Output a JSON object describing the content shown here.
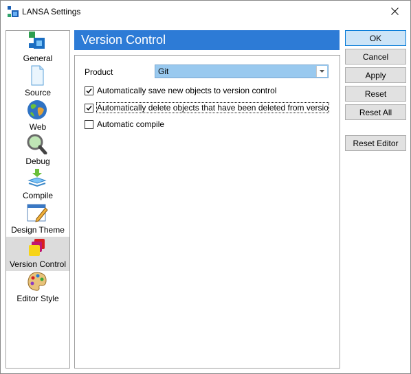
{
  "window": {
    "title": "LANSA Settings"
  },
  "sidebar": {
    "items": [
      {
        "label": "General",
        "icon": "general-icon"
      },
      {
        "label": "Source",
        "icon": "source-icon"
      },
      {
        "label": "Web",
        "icon": "globe-icon"
      },
      {
        "label": "Debug",
        "icon": "magnifier-icon"
      },
      {
        "label": "Compile",
        "icon": "compile-icon"
      },
      {
        "label": "Design Theme",
        "icon": "design-theme-icon"
      },
      {
        "label": "Version Control",
        "icon": "version-control-icon",
        "selected": true
      },
      {
        "label": "Editor Style",
        "icon": "palette-icon"
      }
    ]
  },
  "panel": {
    "title": "Version Control",
    "product_label": "Product",
    "product_value": "Git",
    "checkboxes": [
      {
        "label": "Automatically save new objects to version control",
        "checked": true
      },
      {
        "label": "Automatically delete objects that have been deleted from versio",
        "checked": true,
        "focused": true
      },
      {
        "label": "Automatic compile",
        "checked": false
      }
    ]
  },
  "buttons": {
    "ok": "OK",
    "cancel": "Cancel",
    "apply": "Apply",
    "reset": "Reset",
    "reset_all": "Reset All",
    "reset_editor": "Reset Editor"
  },
  "colors": {
    "header_bg": "#2d7bd6",
    "select_bg": "#99c9ef",
    "default_button_bg": "#cce4f7"
  }
}
